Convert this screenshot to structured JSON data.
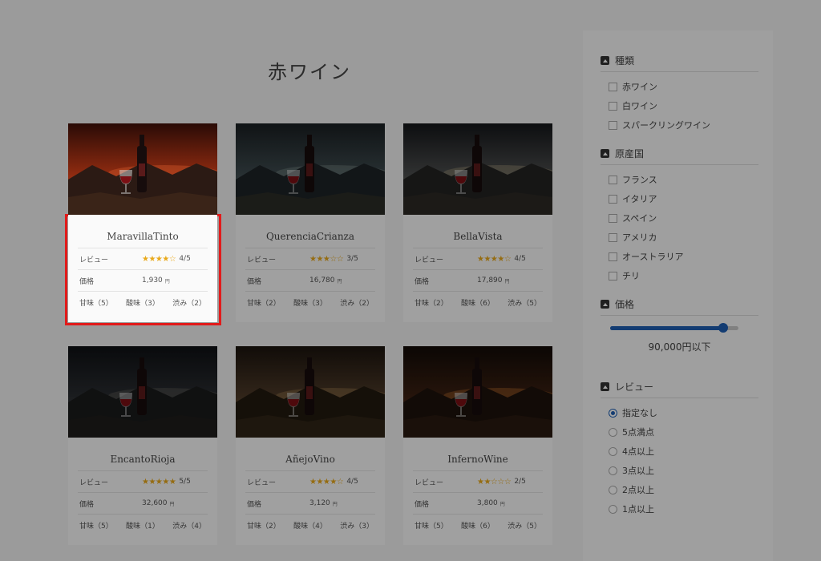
{
  "page_title": "赤ワイン",
  "labels": {
    "review": "レビュー",
    "price": "価格",
    "yen": "円"
  },
  "cards": [
    {
      "name": "MaravillaTinto",
      "stars": "★★★★☆",
      "rating": "4/5",
      "price": "1,930",
      "sweet": "甘味（5）",
      "acid": "酸味（3）",
      "bitter": "渋み（2）",
      "theme": "sunset"
    },
    {
      "name": "QuerenciaCrianza",
      "stars": "★★★☆☆",
      "rating": "3/5",
      "price": "16,780",
      "sweet": "甘味（2）",
      "acid": "酸味（3）",
      "bitter": "渋み（2）",
      "theme": "canyon"
    },
    {
      "name": "BellaVista",
      "stars": "★★★★☆",
      "rating": "4/5",
      "price": "17,890",
      "sweet": "甘味（2）",
      "acid": "酸味（6）",
      "bitter": "渋み（5）",
      "theme": "dusk"
    },
    {
      "name": "EncantoRioja",
      "stars": "★★★★★",
      "rating": "5/5",
      "price": "32,600",
      "sweet": "甘味（5）",
      "acid": "酸味（1）",
      "bitter": "渋み（4）",
      "theme": "night"
    },
    {
      "name": "AñejoVino",
      "stars": "★★★★☆",
      "rating": "4/5",
      "price": "3,120",
      "sweet": "甘味（2）",
      "acid": "酸味（4）",
      "bitter": "渋み（3）",
      "theme": "smoke"
    },
    {
      "name": "InfernoWine",
      "stars": "★★☆☆☆",
      "rating": "2/5",
      "price": "3,800",
      "sweet": "甘味（5）",
      "acid": "酸味（6）",
      "bitter": "渋み（5）",
      "theme": "cellar"
    }
  ],
  "sidebar": {
    "type": {
      "title": "種類",
      "options": [
        "赤ワイン",
        "白ワイン",
        "スパークリングワイン"
      ]
    },
    "origin": {
      "title": "原産国",
      "options": [
        "フランス",
        "イタリア",
        "スペイン",
        "アメリカ",
        "オーストラリア",
        "チリ"
      ]
    },
    "price": {
      "title": "価格",
      "slider_label": "90,000円以下",
      "slider_fraction": 0.88
    },
    "review": {
      "title": "レビュー",
      "options": [
        "指定なし",
        "5点満点",
        "4点以上",
        "3点以上",
        "2点以上",
        "1点以上"
      ],
      "selected_index": 0
    }
  },
  "colors": {
    "accent": "#1f5fb3",
    "star": "#e9a91b",
    "highlight": "#e21a1a"
  }
}
